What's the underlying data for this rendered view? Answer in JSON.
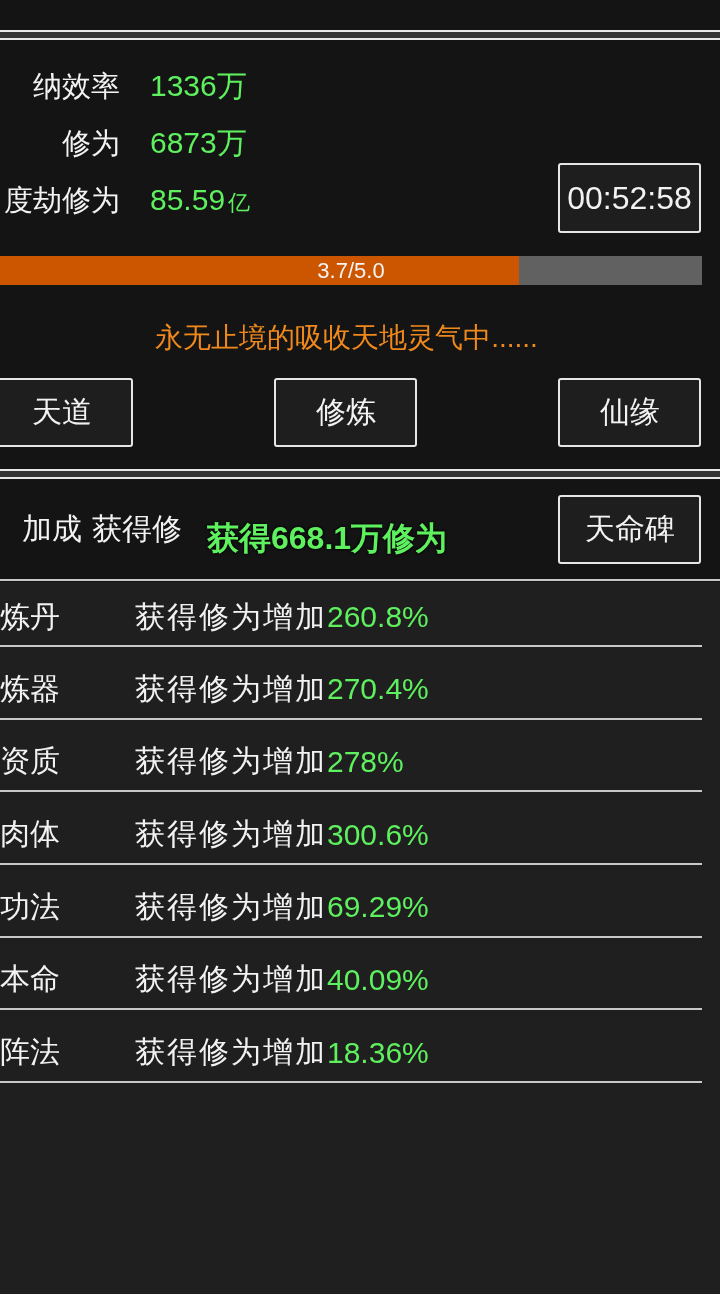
{
  "stats": [
    {
      "label": "纳效率",
      "value": "1336万"
    },
    {
      "label": "修为",
      "value": "6873万"
    },
    {
      "label": "度劫修为",
      "value": "85.59",
      "unit": "亿"
    }
  ],
  "timer": "00:52:58",
  "progress": {
    "level": 0.74,
    "label": "3.7/5.0"
  },
  "status_message": "永无止境的吸收天地灵气中......",
  "nav_buttons": [
    "天道",
    "修炼",
    "仙缘"
  ],
  "bonus_row": {
    "label": "加成",
    "text": "获得修",
    "button": "天命碑"
  },
  "toast": "获得668.1万修为",
  "bonuses": [
    {
      "label": "炼丹",
      "text": "获得修为增加",
      "value": "260.8%"
    },
    {
      "label": "炼器",
      "text": "获得修为增加",
      "value": "270.4%"
    },
    {
      "label": "资质",
      "text": "获得修为增加",
      "value": "278%"
    },
    {
      "label": "肉体",
      "text": "获得修为增加",
      "value": "300.6%"
    },
    {
      "label": "功法",
      "text": "获得修为增加",
      "value": "69.29%"
    },
    {
      "label": "本命",
      "text": "获得修为增加",
      "value": "40.09%"
    },
    {
      "label": "阵法",
      "text": "获得修为增加",
      "value": "18.36%"
    }
  ]
}
